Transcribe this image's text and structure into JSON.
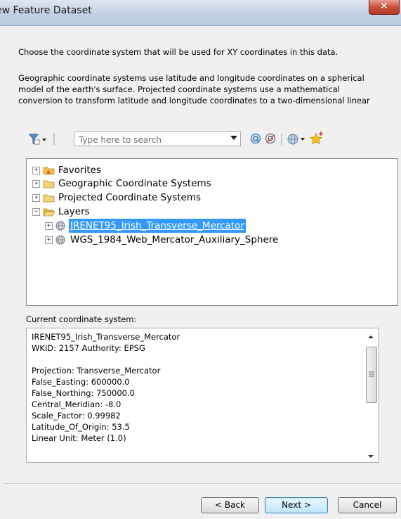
{
  "window": {
    "title": "ew Feature Dataset",
    "close_glyph": "✕"
  },
  "intro": "Choose the coordinate system that will be used for XY coordinates in this data.",
  "description": {
    "line1": "Geographic coordinate systems use latitude and longitude coordinates on a spherical",
    "line2": "model of the earth's surface. Projected coordinate systems use a mathematical",
    "line3": "conversion to transform latitude and longitude coordinates to a two-dimensional linear"
  },
  "toolbar": {
    "search_placeholder": "Type here to search",
    "icons": [
      "filter-icon",
      "search-icon",
      "clear-search-icon",
      "globe-icon",
      "add-favorite-icon"
    ]
  },
  "tree": {
    "items": [
      {
        "label": "Favorites",
        "expander": "+",
        "icon": "favorites-folder-icon"
      },
      {
        "label": "Geographic Coordinate Systems",
        "expander": "+",
        "icon": "folder-icon"
      },
      {
        "label": "Projected Coordinate Systems",
        "expander": "+",
        "icon": "folder-icon"
      },
      {
        "label": "Layers",
        "expander": "−",
        "icon": "open-folder-icon"
      },
      {
        "label": "IRENET95_Irish_Transverse_Mercator",
        "expander": "+",
        "icon": "globe-icon",
        "selected": true
      },
      {
        "label": "WGS_1984_Web_Mercator_Auxiliary_Sphere",
        "expander": "+",
        "icon": "globe-icon"
      }
    ]
  },
  "current": {
    "label": "Current coordinate system:",
    "lines": [
      "IRENET95_Irish_Transverse_Mercator",
      "WKID: 2157 Authority: EPSG",
      "",
      "Projection: Transverse_Mercator",
      "False_Easting: 600000.0",
      "False_Northing: 750000.0",
      "Central_Meridian: -8.0",
      "Scale_Factor: 0.99982",
      "Latitude_Of_Origin: 53.5",
      "Linear Unit: Meter (1.0)"
    ]
  },
  "buttons": {
    "back": "< Back",
    "next": "Next >",
    "cancel": "Cancel"
  }
}
